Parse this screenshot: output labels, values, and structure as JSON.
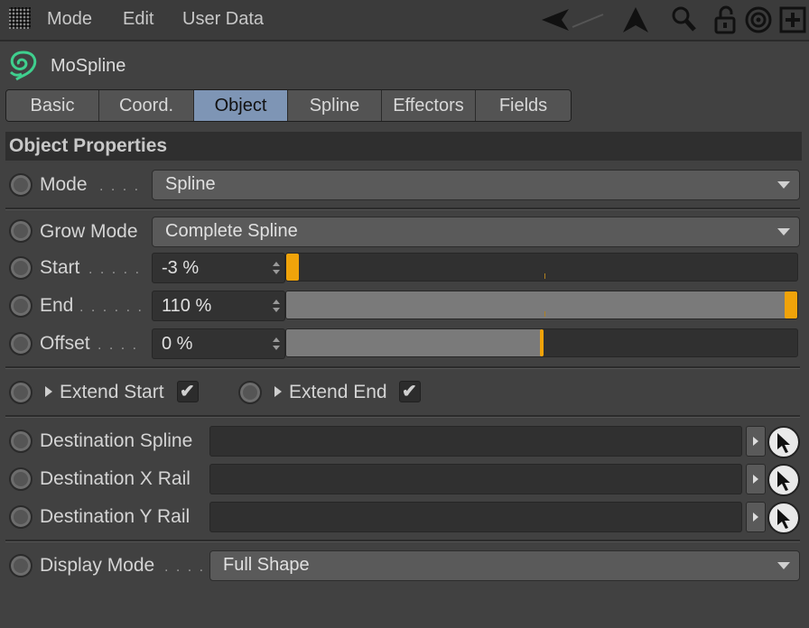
{
  "menubar": {
    "items": [
      "Mode",
      "Edit",
      "User Data"
    ],
    "tools": [
      "back-arrow-icon",
      "forward-arrow-icon",
      "search-icon",
      "lock-icon",
      "target-icon",
      "add-icon"
    ]
  },
  "object": {
    "name": "MoSpline",
    "icon": "mospline-icon"
  },
  "tabs": [
    {
      "label": "Basic",
      "active": false
    },
    {
      "label": "Coord.",
      "active": false
    },
    {
      "label": "Object",
      "active": true
    },
    {
      "label": "Spline",
      "active": false
    },
    {
      "label": "Effectors",
      "active": false
    },
    {
      "label": "Fields",
      "active": false
    }
  ],
  "section": {
    "title": "Object Properties"
  },
  "mode": {
    "label": "Mode",
    "dots": ". . . .",
    "value": "Spline"
  },
  "grow_mode": {
    "label": "Grow Mode",
    "value": "Complete Spline"
  },
  "start": {
    "label": "Start",
    "dots": ". . . . .",
    "value": "-3 %",
    "fraction": 0.0
  },
  "end": {
    "label": "End",
    "dots": ". . . . . .",
    "value": "110 %",
    "fraction": 1.0
  },
  "offset": {
    "label": "Offset",
    "dots": ". . . .",
    "value": "0 %",
    "fraction": 0.5
  },
  "extend_start": {
    "label": "Extend Start",
    "checked": true,
    "mark": "✔"
  },
  "extend_end": {
    "label": "Extend End",
    "checked": true,
    "mark": "✔"
  },
  "dest_spline": {
    "label": "Destination Spline",
    "value": ""
  },
  "dest_x_rail": {
    "label": "Destination X Rail",
    "value": ""
  },
  "dest_y_rail": {
    "label": "Destination Y Rail",
    "value": ""
  },
  "display_mode": {
    "label": "Display Mode",
    "dots": ". . . .",
    "value": "Full Shape"
  },
  "colors": {
    "accent": "#f0a30a",
    "active_tab": "#7e95b5",
    "mospline_icon": "#3fcf8e"
  }
}
